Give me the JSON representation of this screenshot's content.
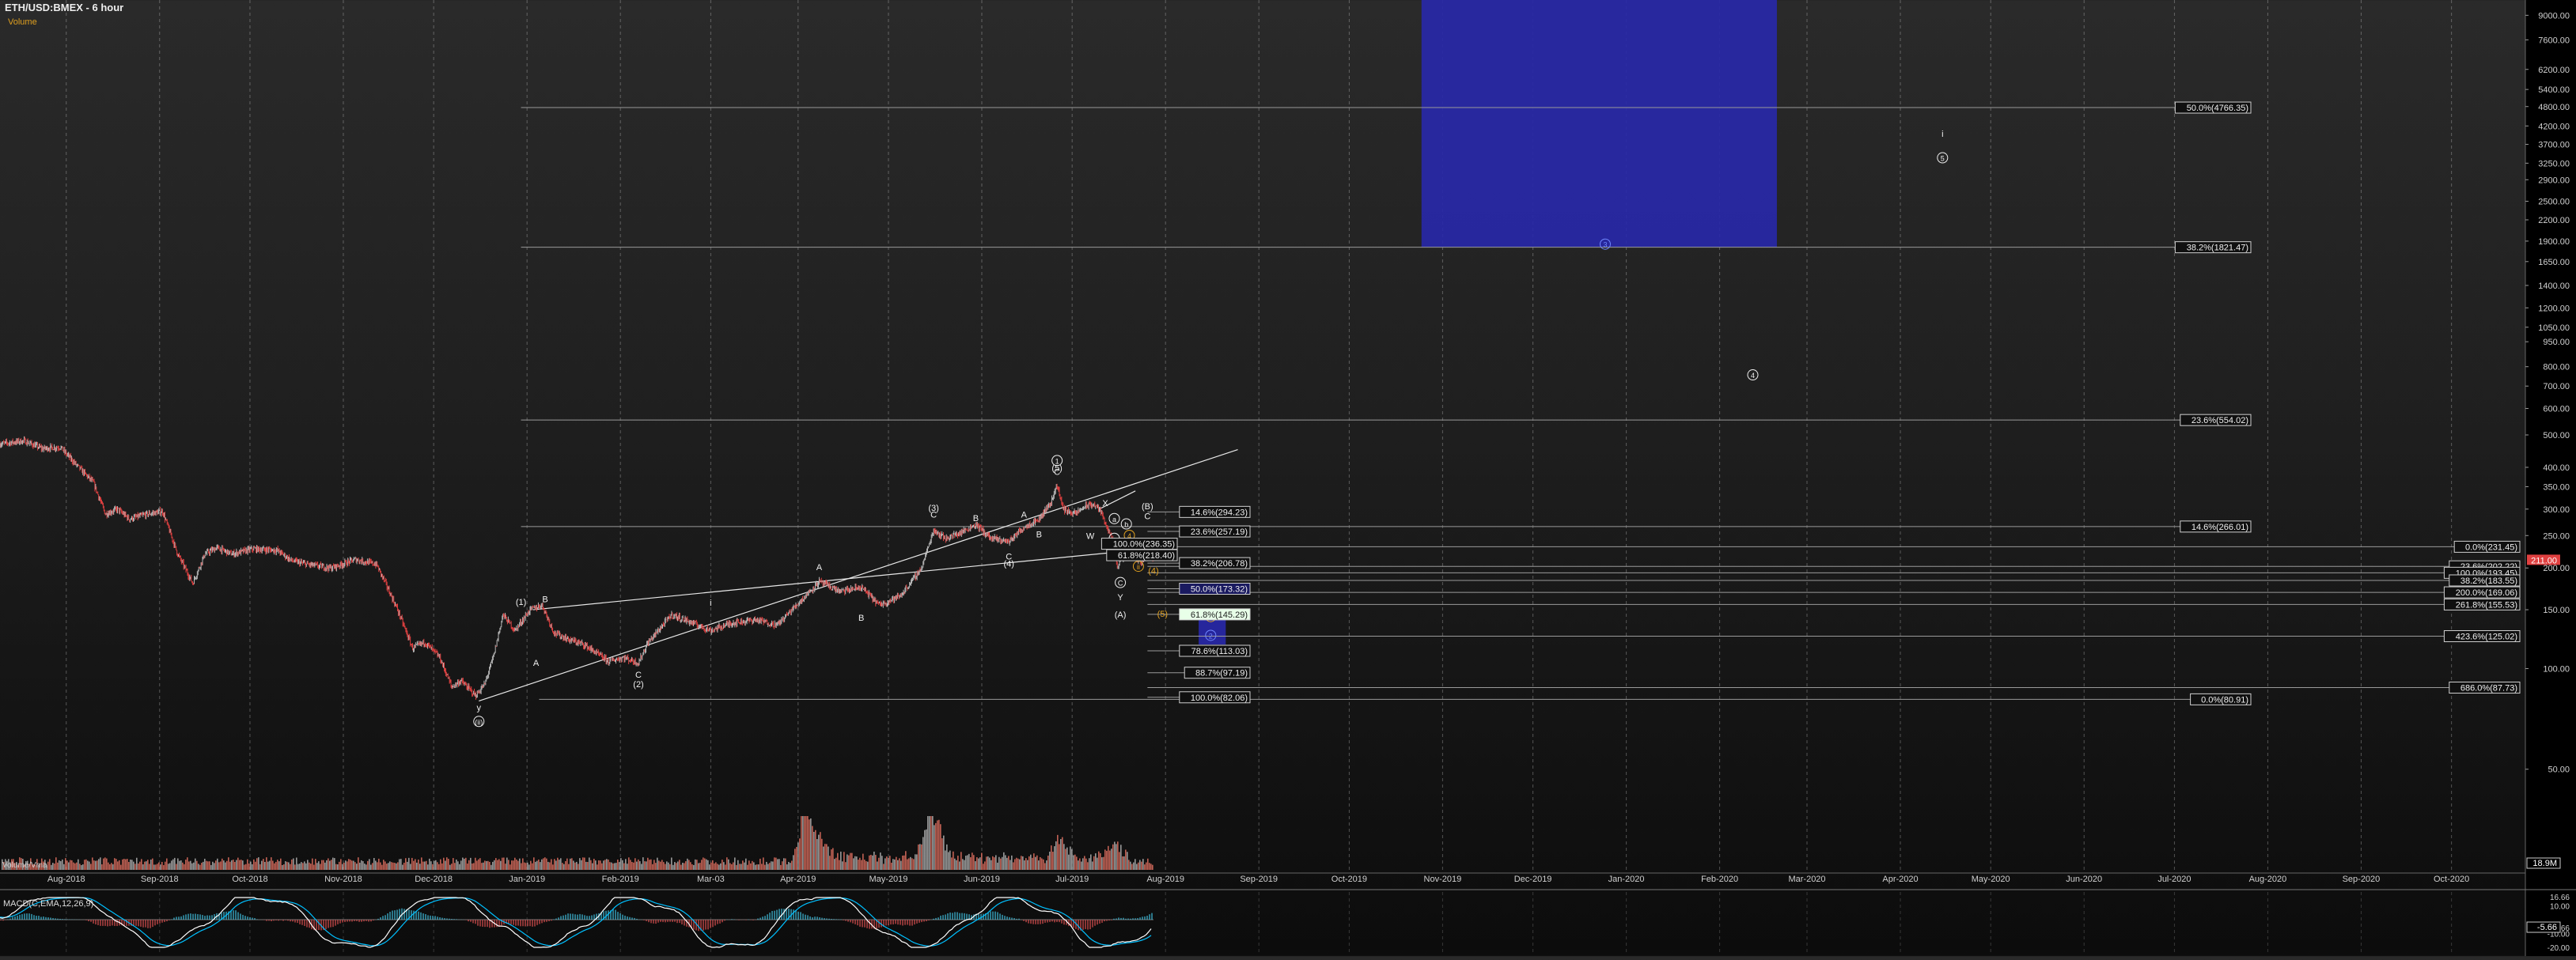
{
  "header": {
    "symbol": "ETH/USD:BMEX - 6 hour",
    "volume_label": "Volume",
    "volume_name": "Volume/Vma",
    "volume_last": "18.9M",
    "macd_label": "MACD(C,EMA,12,26,9)",
    "macd_last": "-5.66"
  },
  "colors": {
    "up": "#b8b8b8",
    "down": "#e04040",
    "fib_line": "#9a9a9a",
    "target_box": "#2828a8",
    "macd_line": "#ffffff",
    "signal_line": "#00c0ff",
    "count_orange": "#e0a020",
    "count_blue": "#7088ff",
    "price_tag": "#e04040"
  },
  "chart_data": [
    {
      "type": "line",
      "name": "price",
      "scale": "log",
      "ylim": [
        25,
        10000
      ],
      "xlim": [
        "2018-07-10",
        "2020-10-25"
      ],
      "x_ticks": [
        "Aug-2018",
        "Sep-2018",
        "Oct-2018",
        "Nov-2018",
        "Dec-2018",
        "Jan-2019",
        "Feb-2019",
        "Mar-03",
        "Apr-2019",
        "May-2019",
        "Jun-2019",
        "Jul-2019",
        "Aug-2019",
        "Sep-2019",
        "Oct-2019",
        "Nov-2019",
        "Dec-2019",
        "Jan-2020",
        "Feb-2020",
        "Mar-2020",
        "Apr-2020",
        "May-2020",
        "Jun-2020",
        "Jul-2020",
        "Aug-2020",
        "Sep-2020",
        "Oct-2020"
      ],
      "x_tick_dates": [
        "2018-08-01",
        "2018-09-01",
        "2018-10-01",
        "2018-11-01",
        "2018-12-01",
        "2019-01-01",
        "2019-02-01",
        "2019-03-03",
        "2019-04-01",
        "2019-05-01",
        "2019-06-01",
        "2019-07-01",
        "2019-08-01",
        "2019-09-01",
        "2019-10-01",
        "2019-11-01",
        "2019-12-01",
        "2020-01-01",
        "2020-02-01",
        "2020-03-01",
        "2020-04-01",
        "2020-05-01",
        "2020-06-01",
        "2020-07-01",
        "2020-08-01",
        "2020-09-01",
        "2020-10-01"
      ],
      "y_ticks": [
        "9000.00",
        "7600.00",
        "6200.00",
        "5400.00",
        "4800.00",
        "4200.00",
        "3700.00",
        "3250.00",
        "2900.00",
        "2500.00",
        "2200.00",
        "1900.00",
        "1650.00",
        "1400.00",
        "1200.00",
        "1050.00",
        "950.00",
        "800.00",
        "700.00",
        "600.00",
        "500.00",
        "400.00",
        "350.00",
        "300.00",
        "250.00",
        "200.00",
        "150.00",
        "100.00",
        "50.00"
      ],
      "price_path": [
        [
          "2018-07-10",
          470
        ],
        [
          "2018-07-18",
          480
        ],
        [
          "2018-07-24",
          455
        ],
        [
          "2018-07-30",
          460
        ],
        [
          "2018-08-04",
          410
        ],
        [
          "2018-08-10",
          360
        ],
        [
          "2018-08-14",
          290
        ],
        [
          "2018-08-18",
          300
        ],
        [
          "2018-08-22",
          280
        ],
        [
          "2018-08-28",
          290
        ],
        [
          "2018-09-02",
          295
        ],
        [
          "2018-09-07",
          220
        ],
        [
          "2018-09-12",
          180
        ],
        [
          "2018-09-16",
          220
        ],
        [
          "2018-09-20",
          230
        ],
        [
          "2018-09-25",
          220
        ],
        [
          "2018-10-02",
          228
        ],
        [
          "2018-10-10",
          226
        ],
        [
          "2018-10-15",
          210
        ],
        [
          "2018-10-20",
          205
        ],
        [
          "2018-10-28",
          200
        ],
        [
          "2018-11-05",
          212
        ],
        [
          "2018-11-12",
          205
        ],
        [
          "2018-11-15",
          180
        ],
        [
          "2018-11-19",
          150
        ],
        [
          "2018-11-24",
          115
        ],
        [
          "2018-11-28",
          120
        ],
        [
          "2018-12-03",
          108
        ],
        [
          "2018-12-07",
          88
        ],
        [
          "2018-12-10",
          92
        ],
        [
          "2018-12-15",
          83
        ],
        [
          "2018-12-18",
          90
        ],
        [
          "2018-12-21",
          110
        ],
        [
          "2018-12-24",
          145
        ],
        [
          "2018-12-28",
          130
        ],
        [
          "2019-01-02",
          150
        ],
        [
          "2019-01-06",
          155
        ],
        [
          "2019-01-10",
          128
        ],
        [
          "2019-01-15",
          122
        ],
        [
          "2019-01-20",
          118
        ],
        [
          "2019-01-28",
          105
        ],
        [
          "2019-02-02",
          108
        ],
        [
          "2019-02-07",
          104
        ],
        [
          "2019-02-10",
          119
        ],
        [
          "2019-02-18",
          145
        ],
        [
          "2019-02-24",
          138
        ],
        [
          "2019-03-03",
          130
        ],
        [
          "2019-03-10",
          137
        ],
        [
          "2019-03-18",
          140
        ],
        [
          "2019-03-25",
          135
        ],
        [
          "2019-04-02",
          160
        ],
        [
          "2019-04-08",
          182
        ],
        [
          "2019-04-15",
          170
        ],
        [
          "2019-04-22",
          175
        ],
        [
          "2019-04-28",
          155
        ],
        [
          "2019-05-05",
          165
        ],
        [
          "2019-05-12",
          200
        ],
        [
          "2019-05-16",
          260
        ],
        [
          "2019-05-20",
          245
        ],
        [
          "2019-05-25",
          255
        ],
        [
          "2019-05-30",
          270
        ],
        [
          "2019-06-04",
          245
        ],
        [
          "2019-06-10",
          240
        ],
        [
          "2019-06-15",
          265
        ],
        [
          "2019-06-20",
          280
        ],
        [
          "2019-06-24",
          315
        ],
        [
          "2019-06-26",
          355
        ],
        [
          "2019-06-28",
          300
        ],
        [
          "2019-07-02",
          290
        ],
        [
          "2019-07-05",
          305
        ],
        [
          "2019-07-08",
          310
        ],
        [
          "2019-07-10",
          300
        ],
        [
          "2019-07-12",
          275
        ],
        [
          "2019-07-15",
          230
        ],
        [
          "2019-07-16",
          200
        ],
        [
          "2019-07-17",
          210
        ],
        [
          "2019-07-19",
          220
        ],
        [
          "2019-07-22",
          215
        ],
        [
          "2019-07-24",
          210
        ],
        [
          "2019-07-26",
          218
        ],
        [
          "2019-07-28",
          211
        ]
      ],
      "last_price": "211.00",
      "channel_lines": [
        [
          [
            "2018-12-16",
            80
          ],
          [
            "2019-08-25",
            452
          ]
        ],
        [
          [
            "2019-01-03",
            150
          ],
          [
            "2019-07-20",
            225
          ]
        ],
        [
          [
            "2019-07-10",
            300
          ],
          [
            "2019-07-22",
            340
          ]
        ]
      ],
      "fib_levels": [
        {
          "label": "50.0%(4766.35)",
          "price": 4766.35,
          "side": "right",
          "start": "2018-12-30"
        },
        {
          "label": "38.2%(1821.47)",
          "price": 1821.47,
          "side": "right",
          "start": "2018-12-30"
        },
        {
          "label": "23.6%(554.02)",
          "price": 554.02,
          "side": "right",
          "start": "2018-12-30"
        },
        {
          "label": "14.6%(266.01)",
          "price": 266.01,
          "side": "right",
          "start": "2018-12-30"
        },
        {
          "label": "0.0%(80.91)",
          "price": 80.91,
          "side": "right",
          "start": "2019-01-05"
        },
        {
          "label": "0.0%(231.45)",
          "price": 231.45,
          "side": "far",
          "start": "2019-07-26"
        },
        {
          "label": "23.6%(202.22)",
          "price": 202.22,
          "side": "far",
          "start": "2019-07-26"
        },
        {
          "label": "100.0%(193.45)",
          "price": 193.45,
          "side": "far",
          "start": "2019-07-26"
        },
        {
          "label": "38.2%(183.55)",
          "price": 183.55,
          "side": "far",
          "start": "2019-07-26"
        },
        {
          "label": "200.0%(169.06)",
          "price": 169.06,
          "side": "far",
          "start": "2019-07-26"
        },
        {
          "label": "261.8%(155.53)",
          "price": 155.53,
          "side": "far",
          "start": "2019-07-26"
        },
        {
          "label": "423.6%(125.02)",
          "price": 125.02,
          "side": "far",
          "start": "2019-07-26"
        },
        {
          "label": "686.0%(87.73)",
          "price": 87.73,
          "side": "far",
          "start": "2019-07-26"
        },
        {
          "label": "14.6%(294.23)",
          "price": 294.23,
          "side": "mid",
          "start": "2019-07-26"
        },
        {
          "label": "23.6%(257.19)",
          "price": 257.19,
          "side": "mid",
          "start": "2019-07-26"
        },
        {
          "label": "100.0%(236.35)",
          "price": 236.35,
          "side": "mid2",
          "start": "2019-07-19"
        },
        {
          "label": "61.8%(218.40)",
          "price": 218.4,
          "side": "mid2",
          "start": "2019-07-19"
        },
        {
          "label": "38.2%(206.78)",
          "price": 206.78,
          "side": "mid",
          "start": "2019-07-26"
        },
        {
          "label": "50.0%(173.32)",
          "price": 173.32,
          "side": "mid",
          "start": "2019-07-26",
          "box": "#1a1a60"
        },
        {
          "label": "61.8%(145.29)",
          "price": 145.29,
          "side": "mid",
          "start": "2019-07-26",
          "box": "#e8ffe8"
        },
        {
          "label": "78.6%(113.03)",
          "price": 113.03,
          "side": "mid",
          "start": "2019-07-26"
        },
        {
          "label": "88.7%(97.19)",
          "price": 97.19,
          "side": "mid",
          "start": "2019-07-26"
        },
        {
          "label": "100.0%(82.06)",
          "price": 82.06,
          "side": "mid",
          "start": "2019-07-26"
        }
      ],
      "target_boxes": [
        {
          "x0": "2019-10-25",
          "x1": "2020-02-20",
          "y0": 1821.47,
          "y1": 10000
        },
        {
          "x0": "2019-08-12",
          "x1": "2019-08-21",
          "y0": 118,
          "y1": 150
        }
      ],
      "wave_labels": [
        {
          "text": "ii",
          "date": "2018-12-16",
          "price": 68,
          "color": "white",
          "circled": true,
          "paren": true
        },
        {
          "text": "y",
          "date": "2018-12-16",
          "price": 75
        },
        {
          "text": "(1)",
          "date": "2018-12-30",
          "price": 155
        },
        {
          "text": "A",
          "date": "2019-01-04",
          "price": 102
        },
        {
          "text": "B",
          "date": "2019-01-07",
          "price": 158
        },
        {
          "text": "C",
          "date": "2019-02-07",
          "price": 94
        },
        {
          "text": "(2)",
          "date": "2019-02-07",
          "price": 88
        },
        {
          "text": "i",
          "date": "2019-03-03",
          "price": 154
        },
        {
          "text": "A",
          "date": "2019-04-08",
          "price": 197
        },
        {
          "text": "B",
          "date": "2019-04-22",
          "price": 139
        },
        {
          "text": "C",
          "date": "2019-05-16",
          "price": 283
        },
        {
          "text": "(3)",
          "date": "2019-05-16",
          "price": 296
        },
        {
          "text": "B",
          "date": "2019-05-30",
          "price": 276
        },
        {
          "text": "C",
          "date": "2019-06-10",
          "price": 212
        },
        {
          "text": "(4)",
          "date": "2019-06-10",
          "price": 202
        },
        {
          "text": "A",
          "date": "2019-06-15",
          "price": 283
        },
        {
          "text": "B",
          "date": "2019-06-20",
          "price": 247
        },
        {
          "text": "C",
          "date": "2019-06-26",
          "price": 380
        },
        {
          "text": "(5)",
          "date": "2019-06-26",
          "price": 390
        },
        {
          "text": "1",
          "date": "2019-06-26",
          "price": 410,
          "circled": true
        },
        {
          "text": "W",
          "date": "2019-07-07",
          "price": 244
        },
        {
          "text": "X",
          "date": "2019-07-12",
          "price": 306
        },
        {
          "text": "a",
          "date": "2019-07-15",
          "price": 275,
          "circled": true
        },
        {
          "text": "b",
          "date": "2019-07-19",
          "price": 265,
          "circled": true
        },
        {
          "text": "c",
          "date": "2019-07-15",
          "price": 240,
          "circled": true
        },
        {
          "text": "C",
          "date": "2019-07-17",
          "price": 177,
          "circled": true
        },
        {
          "text": "Y",
          "date": "2019-07-17",
          "price": 160
        },
        {
          "text": "(A)",
          "date": "2019-07-17",
          "price": 142
        },
        {
          "text": "(B)",
          "date": "2019-07-26",
          "price": 300
        },
        {
          "text": "C",
          "date": "2019-07-26",
          "price": 280
        },
        {
          "text": "4",
          "date": "2019-07-20",
          "price": 245,
          "circled": true,
          "color": "orange"
        },
        {
          "text": "i",
          "date": "2019-07-23",
          "price": 227,
          "circled": true,
          "color": "orange"
        },
        {
          "text": "ii",
          "date": "2019-07-23",
          "price": 198,
          "circled": true,
          "color": "orange"
        },
        {
          "text": "(4)",
          "date": "2019-07-28",
          "price": 192,
          "color": "orange"
        },
        {
          "text": "(5)",
          "date": "2019-07-31",
          "price": 143,
          "color": "orange"
        },
        {
          "text": "C",
          "date": "2019-08-16",
          "price": 140,
          "circled": true,
          "color": "orange"
        },
        {
          "text": "2",
          "date": "2019-08-16",
          "price": 123,
          "circled": true,
          "color": "blue"
        },
        {
          "text": "3",
          "date": "2019-12-25",
          "price": 1821,
          "circled": true,
          "color": "blue"
        },
        {
          "text": "4",
          "date": "2020-02-12",
          "price": 740,
          "circled": true
        },
        {
          "text": "i",
          "date": "2020-04-15",
          "price": 3900
        },
        {
          "text": "5",
          "date": "2020-04-15",
          "price": 3300,
          "circled": true
        }
      ]
    },
    {
      "type": "bar",
      "name": "Volume/Vma",
      "last": "18.9M"
    },
    {
      "type": "line",
      "name": "MACD(C,EMA,12,26,9)",
      "y_ticks": [
        "16.66",
        "10.00",
        "-5.66",
        "-10.00",
        "-20.00"
      ],
      "ylim": [
        -24,
        20
      ]
    }
  ]
}
